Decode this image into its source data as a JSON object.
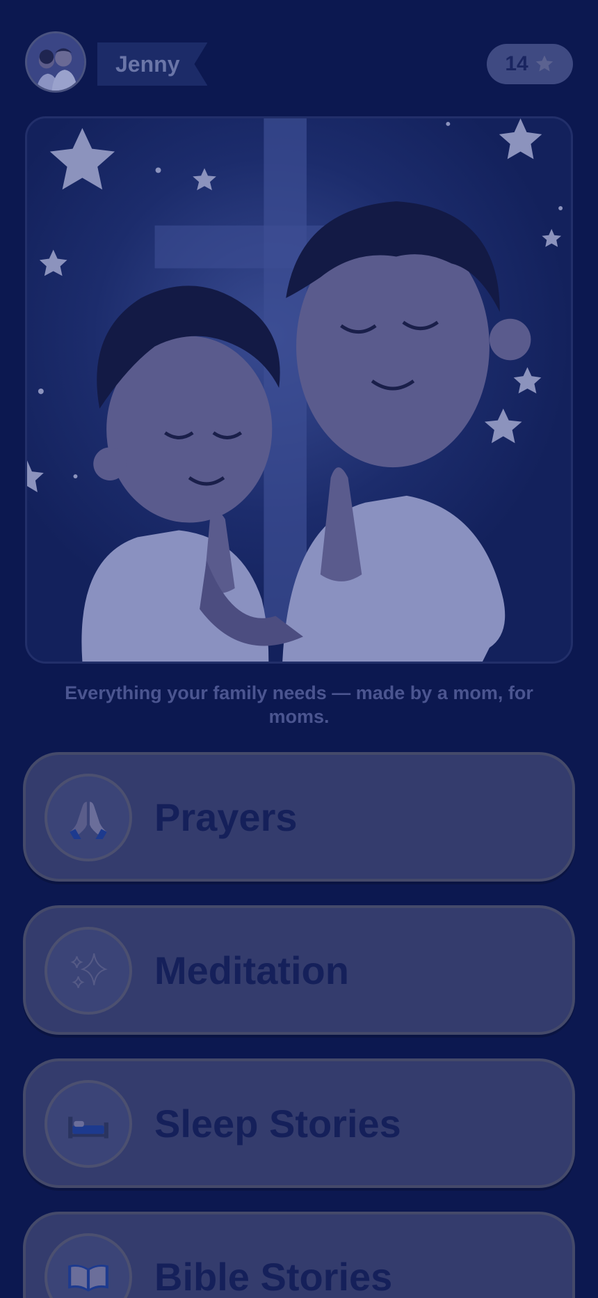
{
  "header": {
    "avatar_icon": "family-avatar-icon",
    "user_name": "Jenny",
    "star_count": "14",
    "star_icon": "star-icon"
  },
  "hero": {
    "image": "children-praying-illustration"
  },
  "tagline": "Everything your family needs — made by a mom, for moms.",
  "menu": [
    {
      "label": "Prayers",
      "icon": "praying-hands-icon"
    },
    {
      "label": "Meditation",
      "icon": "sparkles-icon"
    },
    {
      "label": "Sleep Stories",
      "icon": "bed-icon"
    },
    {
      "label": "Bible Stories",
      "icon": "open-book-icon"
    }
  ],
  "colors": {
    "background": "#0c1850",
    "card": "#343c6d",
    "card_text": "#15205a",
    "tagline": "#4b5590"
  }
}
